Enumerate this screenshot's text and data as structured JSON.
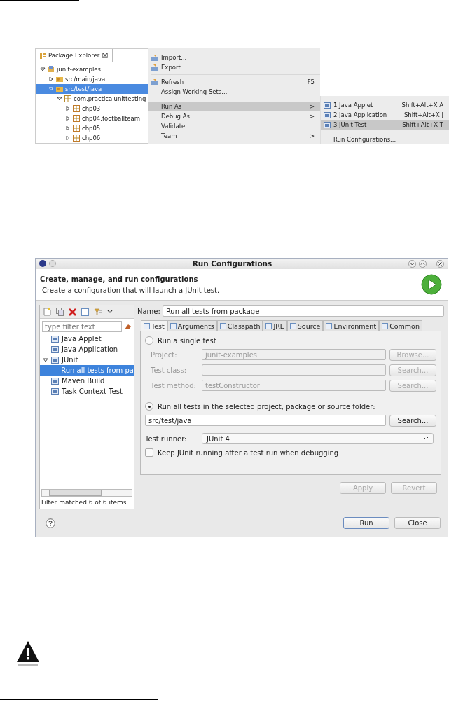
{
  "explorer": {
    "tab": "Package Explorer",
    "tree": [
      {
        "label": "junit-examples",
        "expanded": true,
        "selected": false,
        "children": [
          {
            "label": "src/main/java",
            "expanded": false,
            "selected": false
          },
          {
            "label": "src/test/java",
            "expanded": true,
            "selected": true,
            "children": [
              {
                "label": "com.practicalunittesting",
                "expanded": true,
                "selected": false,
                "children": [
                  {
                    "label": "chp03",
                    "expanded": false,
                    "selected": false
                  },
                  {
                    "label": "chp04.footballteam",
                    "expanded": false,
                    "selected": false
                  },
                  {
                    "label": "chp05",
                    "expanded": false,
                    "selected": false
                  },
                  {
                    "label": "chp06",
                    "expanded": false,
                    "selected": false
                  }
                ]
              }
            ]
          }
        ]
      }
    ]
  },
  "context_menu": {
    "groups": [
      [
        {
          "label": "Import...",
          "icon": true,
          "selected": false
        },
        {
          "label": "Export...",
          "icon": true,
          "selected": false
        }
      ],
      [
        {
          "label": "Refresh",
          "shortcut": "F5",
          "icon": true,
          "selected": false
        },
        {
          "label": "Assign Working Sets...",
          "selected": false
        }
      ],
      [
        {
          "label": "Run As",
          "submenu": ">",
          "selected": true
        },
        {
          "label": "Debug As",
          "submenu": ">",
          "selected": false
        },
        {
          "label": "Validate",
          "selected": false
        },
        {
          "label": "Team",
          "submenu": ">",
          "selected": false
        }
      ]
    ]
  },
  "submenu": {
    "groups": [
      [
        {
          "label": "1 Java Applet",
          "shortcut": "Shift+Alt+X A",
          "selected": false
        },
        {
          "label": "2 Java Application",
          "shortcut": "Shift+Alt+X J",
          "selected": false
        },
        {
          "label": "3 JUnit Test",
          "shortcut": "Shift+Alt+X T",
          "selected": true
        }
      ],
      [
        {
          "label": "Run Configurations...",
          "selected": false
        }
      ]
    ]
  },
  "dialog": {
    "title": "Run Configurations",
    "header_title": "Create, manage, and run configurations",
    "header_subtitle": "Create a configuration that will launch a JUnit test.",
    "filter_placeholder": "type filter text",
    "tree": [
      {
        "label": "Java Applet",
        "selected": false
      },
      {
        "label": "Java Application",
        "selected": false
      },
      {
        "label": "JUnit",
        "expanded": true,
        "selected": false,
        "children": [
          {
            "label": "Run all tests from pa",
            "selected": true
          }
        ]
      },
      {
        "label": "Maven Build",
        "selected": false
      },
      {
        "label": "Task Context Test",
        "selected": false
      }
    ],
    "filter_status": "Filter matched 6 of 6 items",
    "name_label": "Name:",
    "name_value": "Run all tests from package",
    "tabs": [
      {
        "label": "Test",
        "selected": true
      },
      {
        "label": "Arguments",
        "selected": false
      },
      {
        "label": "Classpath",
        "selected": false
      },
      {
        "label": "JRE",
        "selected": false
      },
      {
        "label": "Source",
        "selected": false
      },
      {
        "label": "Environment",
        "selected": false
      },
      {
        "label": "Common",
        "selected": false
      }
    ],
    "single_test": {
      "label": "Run a single test",
      "selected": false
    },
    "fields": [
      {
        "label": "Project:",
        "value": "junit-examples",
        "button": "Browse...",
        "disabled": true
      },
      {
        "label": "Test class:",
        "button": "Search...",
        "disabled": true
      },
      {
        "label": "Test method:",
        "value": "testConstructor",
        "button": "Search...",
        "disabled": true
      }
    ],
    "all_tests": {
      "label": "Run all tests in the selected project, package or source folder:",
      "selected": true
    },
    "folder": {
      "value": "src/test/java",
      "button": "Search..."
    },
    "runner_label": "Test runner:",
    "runner_value": "JUnit 4",
    "keep_running": {
      "label": "Keep JUnit running after a test run when debugging",
      "checked": false
    },
    "apply": {
      "label": "Apply",
      "disabled": true
    },
    "revert": {
      "label": "Revert",
      "disabled": true
    },
    "run": "Run",
    "close": "Close"
  }
}
